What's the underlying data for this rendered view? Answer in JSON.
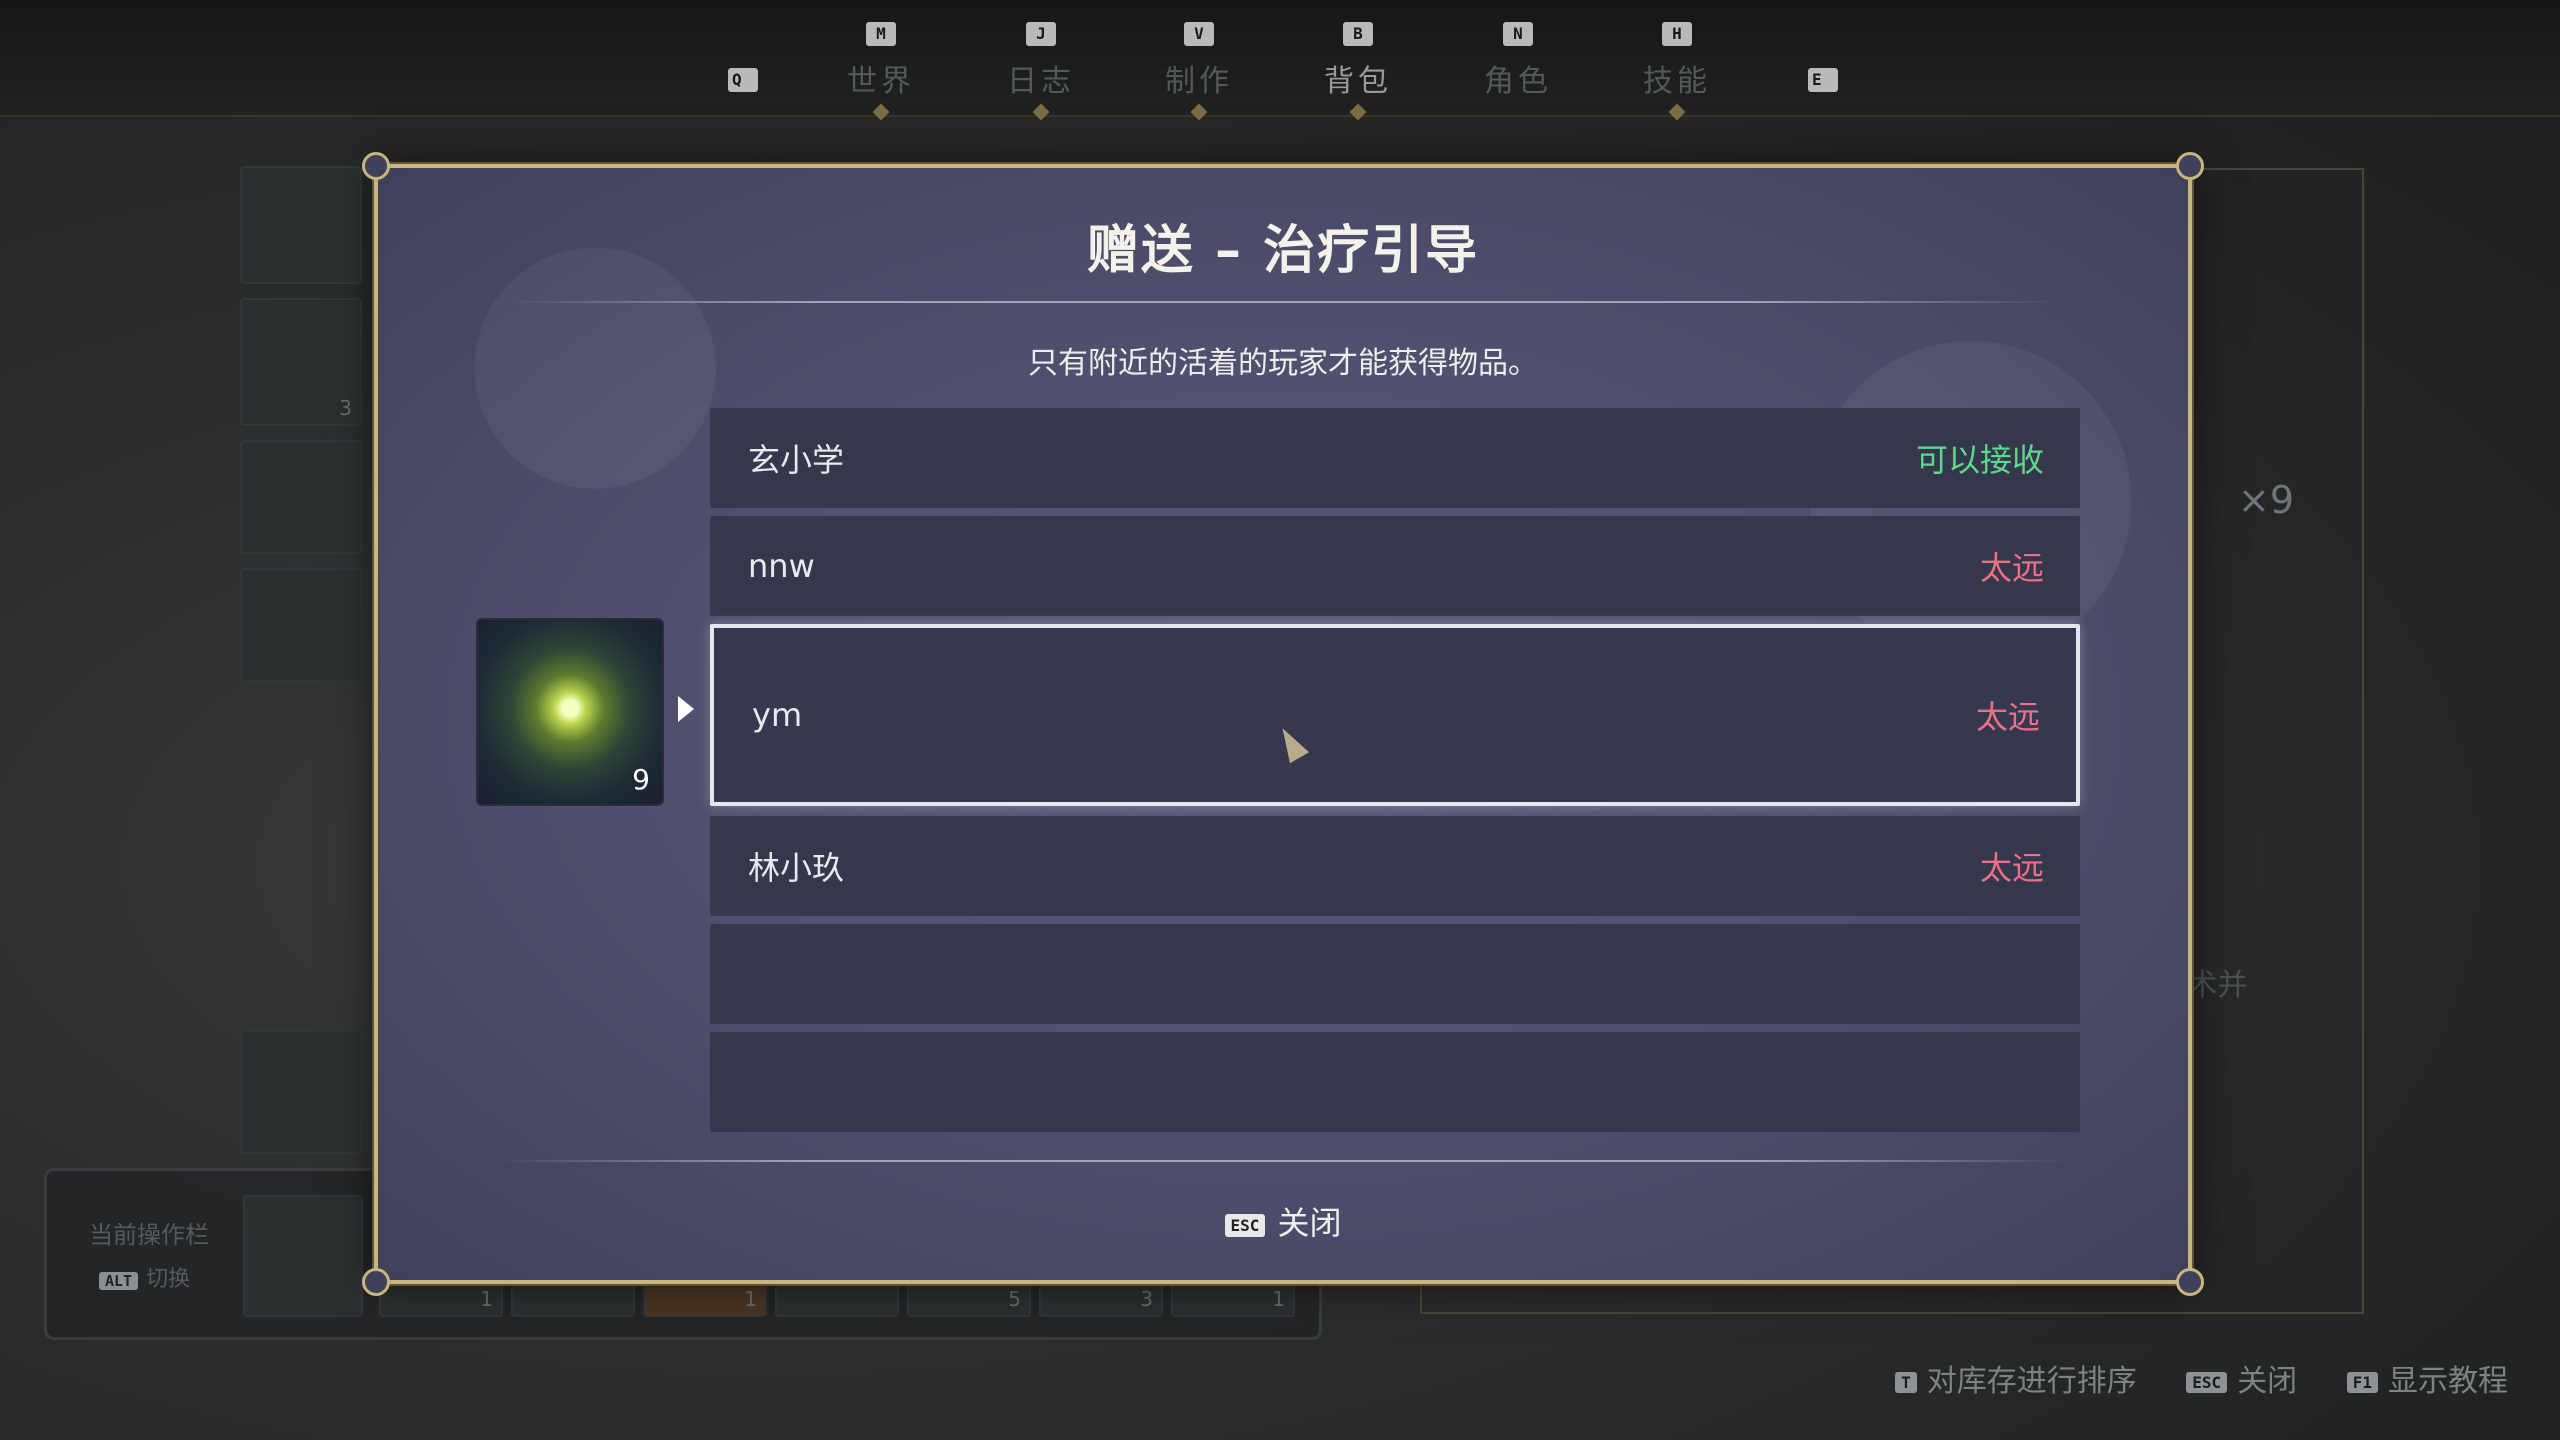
{
  "nav": {
    "left_key": "Q",
    "right_key": "E",
    "tabs": [
      {
        "key": "M",
        "label": "世界"
      },
      {
        "key": "J",
        "label": "日志"
      },
      {
        "key": "V",
        "label": "制作"
      },
      {
        "key": "B",
        "label": "背包"
      },
      {
        "key": "N",
        "label": "角色"
      },
      {
        "key": "H",
        "label": "技能"
      }
    ],
    "active_tab": "背包"
  },
  "background": {
    "slot_counts": [
      "3",
      "1",
      "1",
      "5",
      "3",
      "1"
    ],
    "hotbar": {
      "title": "当前操作栏",
      "alt_key": "ALT",
      "alt_label": "切换"
    },
    "right_panel": {
      "count": "×9",
      "text": "k术并"
    }
  },
  "dialog": {
    "title": "赠送 – 治疗引导",
    "subtitle": "只有附近的活着的玩家才能获得物品。",
    "item": {
      "count": "9",
      "icon": "green-orb-spell-icon"
    },
    "players": [
      {
        "name": "玄小学",
        "status": "可以接收",
        "status_color": "#5fd68a"
      },
      {
        "name": "nnw",
        "status": "太远",
        "status_color": "#ee6f86"
      },
      {
        "name": "ym",
        "status": "太远",
        "status_color": "#ee6f86",
        "selected": true
      },
      {
        "name": "林小玖",
        "status": "太远",
        "status_color": "#ee6f86"
      }
    ],
    "close_key": "ESC",
    "close_label": "关闭"
  },
  "hints": [
    {
      "key": "T",
      "label": "对库存进行排序"
    },
    {
      "key": "ESC",
      "label": "关闭"
    },
    {
      "key": "F1",
      "label": "显示教程"
    }
  ]
}
